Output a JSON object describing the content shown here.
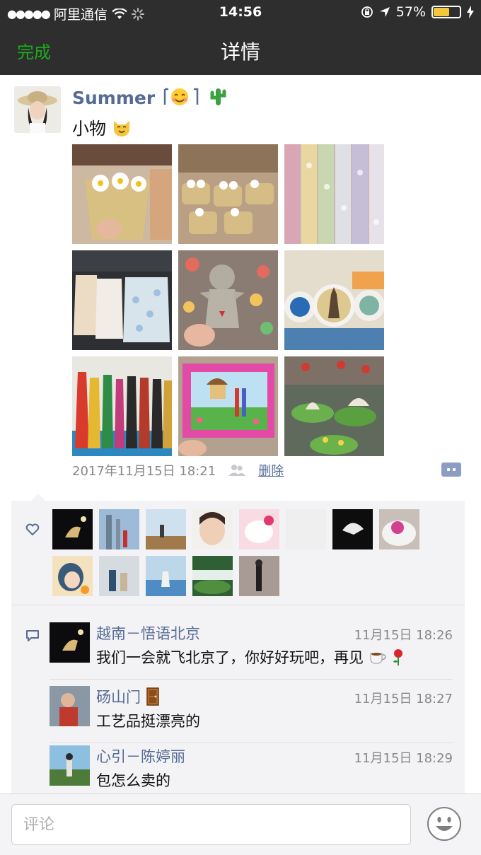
{
  "status_bar": {
    "carrier": "阿里通信",
    "time": "14:56",
    "battery": "57%",
    "battery_level": 0.57
  },
  "nav": {
    "done_label": "完成",
    "title": "详情"
  },
  "post": {
    "username": "Summer",
    "content": "小物",
    "timestamp": "2017年11月15日 18:21",
    "delete_label": "删除"
  },
  "comments": [
    {
      "name": "越南－悟语北京",
      "time": "11月15日 18:26",
      "text": "我们一会就飞北京了，你好好玩吧，再见"
    },
    {
      "name": "砀山门",
      "time": "11月15日 18:27",
      "text": "工艺品挺漂亮的"
    },
    {
      "name": "心引－陈婷丽",
      "time": "11月15日 18:29",
      "text": "包怎么卖的"
    }
  ],
  "input": {
    "placeholder": "评论"
  },
  "colors": {
    "bar_bg": "#2e2e2f",
    "accent_green": "#1aad19",
    "link_blue": "#576b95",
    "panel_bg": "#f3f3f5"
  }
}
